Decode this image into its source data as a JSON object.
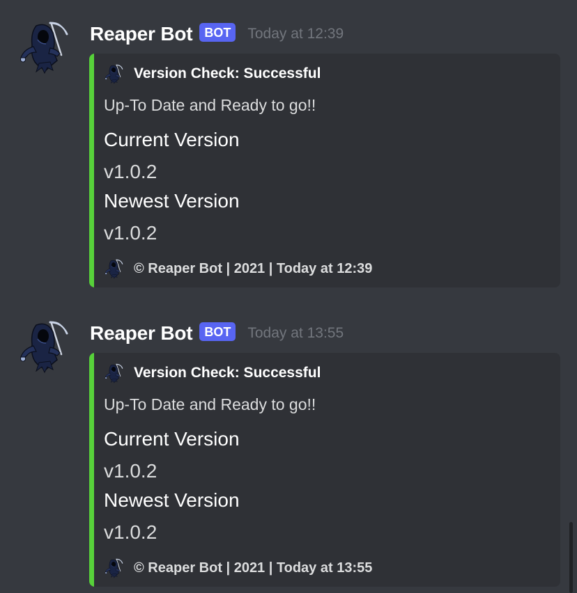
{
  "messages": [
    {
      "author": "Reaper Bot",
      "badge": "BOT",
      "timestamp": "Today at 12:39",
      "avatar_icon": "grim-reaper-icon",
      "embed": {
        "accent_color": "#57d13a",
        "author": "Version Check: Successful",
        "description": "Up-To Date and Ready to go!!",
        "fields": [
          {
            "name": "Current Version",
            "value": "v1.0.2"
          },
          {
            "name": "Newest Version",
            "value": "v1.0.2"
          }
        ],
        "footer": "© Reaper Bot | 2021 | Today at 12:39"
      }
    },
    {
      "author": "Reaper Bot",
      "badge": "BOT",
      "timestamp": "Today at 13:55",
      "avatar_icon": "grim-reaper-icon",
      "embed": {
        "accent_color": "#57d13a",
        "author": "Version Check: Successful",
        "description": "Up-To Date and Ready to go!!",
        "fields": [
          {
            "name": "Current Version",
            "value": "v1.0.2"
          },
          {
            "name": "Newest Version",
            "value": "v1.0.2"
          }
        ],
        "footer": "© Reaper Bot | 2021 | Today at 13:55"
      }
    }
  ],
  "colors": {
    "background": "#36393f",
    "embed_background": "#2f3136",
    "badge": "#5865f2",
    "timestamp": "#72767d"
  }
}
